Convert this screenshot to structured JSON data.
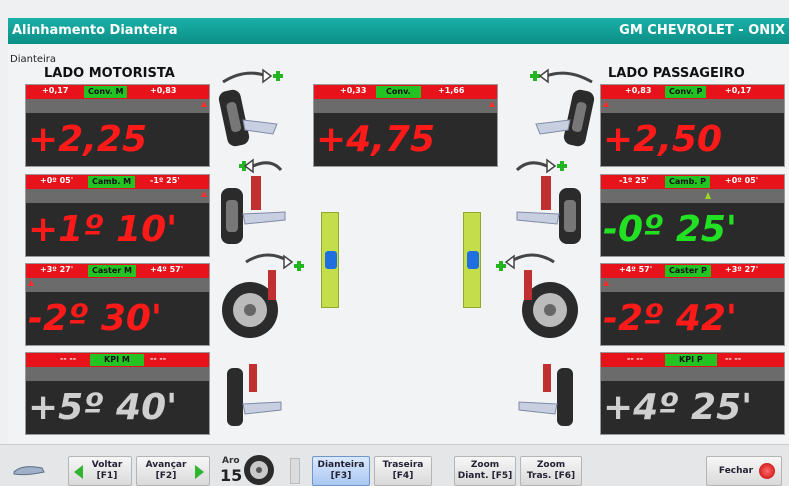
{
  "title": {
    "left": "Alinhamento Dianteira",
    "right": "GM CHEVROLET - ONIX"
  },
  "section_label": "Dianteira",
  "sides": {
    "left": "LADO MOTORISTA",
    "right": "LADO PASSAGEIRO"
  },
  "panels": {
    "conv_m": {
      "min": "+0,17",
      "name": "Conv. M",
      "max": "+0,83",
      "value": "+2,25"
    },
    "conv": {
      "min": "+0,33",
      "name": "Conv.",
      "max": "+1,66",
      "value": "+4,75"
    },
    "conv_p": {
      "min": "+0,83",
      "name": "Conv. P",
      "max": "+0,17",
      "value": "+2,50"
    },
    "camb_m": {
      "min": "+0º 05'",
      "name": "Camb. M",
      "max": "-1º 25'",
      "value": "+1º 10'"
    },
    "camb_p": {
      "min": "-1º 25'",
      "name": "Camb. P",
      "max": "+0º 05'",
      "value": "-0º 25'"
    },
    "caster_m": {
      "min": "+3º 27'",
      "name": "Caster M",
      "max": "+4º 57'",
      "value": "-2º 30'"
    },
    "caster_p": {
      "min": "+4º 57'",
      "name": "Caster P",
      "max": "+3º 27'",
      "value": "-2º 42'"
    },
    "kpi_m": {
      "min": "-- --",
      "name": "KPI M",
      "max": "-- --",
      "value": "+5º 40'"
    },
    "kpi_p": {
      "min": "-- --",
      "name": "KPI P",
      "max": "-- --",
      "value": "+4º 25'"
    }
  },
  "toolbar": {
    "voltar": {
      "line1": "Voltar",
      "line2": "[F1]"
    },
    "avancar": {
      "line1": "Avançar",
      "line2": "[F2]"
    },
    "aro": {
      "label": "Aro",
      "value": "15"
    },
    "dianteira": {
      "line1": "Dianteira",
      "line2": "[F3]"
    },
    "traseira": {
      "line1": "Traseira",
      "line2": "[F4]"
    },
    "zoom_diant": {
      "line1": "Zoom",
      "line2": "Diant. [F5]"
    },
    "zoom_tras": {
      "line1": "Zoom",
      "line2": "Tras. [F6]"
    },
    "fechar": "Fechar"
  },
  "colors": {
    "accent": "#0b8f86",
    "bad": "#ff1a1a",
    "good": "#22e022"
  }
}
